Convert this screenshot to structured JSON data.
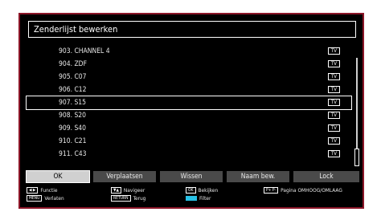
{
  "title": "Zenderlijst bewerken",
  "channels": [
    {
      "name": "903. CHANNEL 4",
      "type": "TV"
    },
    {
      "name": "904. ZDF",
      "type": "TV"
    },
    {
      "name": "905. C07",
      "type": "TV"
    },
    {
      "name": "906. C12",
      "type": "TV"
    },
    {
      "name": "907. S15",
      "type": "TV"
    },
    {
      "name": "908. S20",
      "type": "TV"
    },
    {
      "name": "909. S40",
      "type": "TV"
    },
    {
      "name": "910. C21",
      "type": "TV"
    },
    {
      "name": "911. C43",
      "type": "TV"
    }
  ],
  "selected_channel_index": 4,
  "buttons": [
    "OK",
    "Verplaatsen",
    "Wissen",
    "Naam bew.",
    "Lock"
  ],
  "selected_button_index": 0,
  "legend": {
    "function_label": "Functie",
    "menu_key": "MENU",
    "menu_label": "Verlaten",
    "navigate_label": "Navigeer",
    "return_key": "RETURN",
    "return_label": "Terug",
    "ok_key": "OK",
    "view_label": "Bekijken",
    "filter_label": "Filter",
    "page_keys": "P+ P-",
    "page_label": "Pagina OMHOOG/OMLAAG"
  },
  "colors": {
    "frame_border": "#8c1628",
    "filter_key": "#27c1e6",
    "panel": "#000000"
  }
}
